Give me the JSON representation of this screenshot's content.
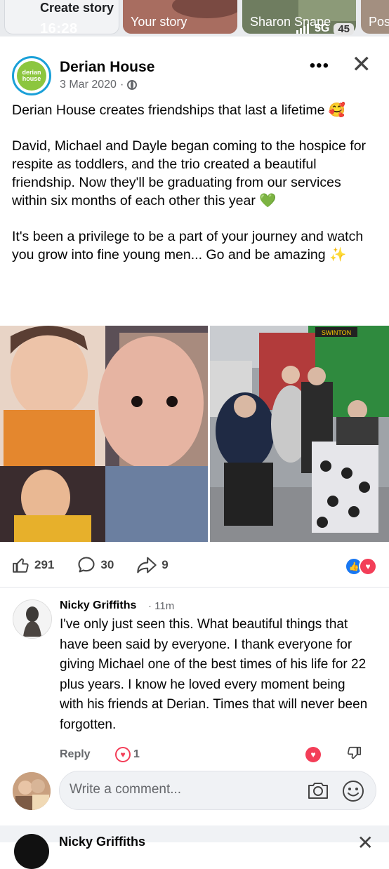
{
  "status_bar": {
    "time": "16:28",
    "network": "5G",
    "battery": "45"
  },
  "stories": [
    {
      "label": "Create story"
    },
    {
      "label": "Your story"
    },
    {
      "label": "Sharon Snape"
    },
    {
      "label": "Pos"
    }
  ],
  "post": {
    "page_name": "Derian House",
    "date": "3 Mar 2020",
    "logo_text": "derian house",
    "paragraphs": [
      "Derian House creates friendships that last a lifetime 🥰",
      "David, Michael and Dayle began coming to the hospice for respite as toddlers, and the trio created a beautiful friendship. Now they'll be graduating from our services within six months of each other this year 💚",
      "It's been a privilege to be a part of your journey and watch you grow into fine young men... Go and be amazing ✨"
    ],
    "photo_right_sign": "SWINTON",
    "likes": "291",
    "comments": "30",
    "shares": "9"
  },
  "comment": {
    "author": "Nicky Griffiths",
    "time": "11m",
    "text": "I've only just seen this. What beautiful things that have been said by everyone. I thank everyone for giving Michael one of the best times of his life for 22 plus years. I know he loved every moment being with his friends at Derian.  Times that will never been forgotten.",
    "reply_label": "Reply",
    "reaction_count": "1"
  },
  "composer": {
    "placeholder": "Write a comment..."
  },
  "next_post": {
    "name": "Nicky Griffiths"
  },
  "colors": {
    "accent": "#1877f2",
    "love": "#f33e58",
    "logo_green": "#8cc63f",
    "logo_blue": "#1aa0d8"
  },
  "icons": [
    "like-icon",
    "comment-icon",
    "share-icon",
    "globe-icon",
    "camera-icon",
    "smiley-icon",
    "close-icon",
    "more-icon",
    "thumbs-down-icon"
  ]
}
